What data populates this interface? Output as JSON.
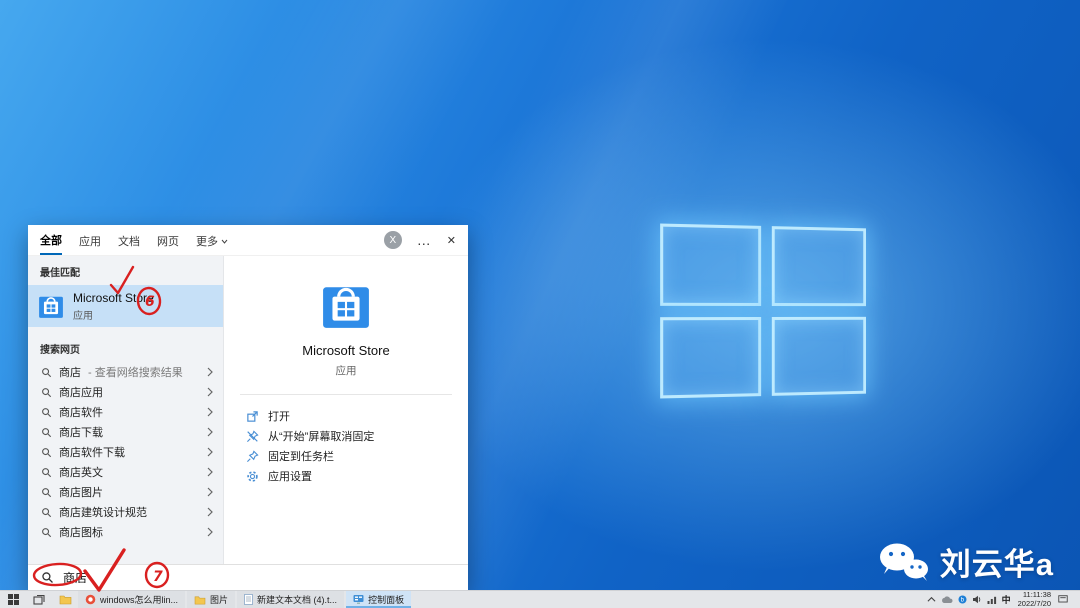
{
  "search_panel": {
    "tabs": {
      "all": "全部",
      "apps": "应用",
      "documents": "文档",
      "web": "网页",
      "more": "更多"
    },
    "header": {
      "clear_badge": "X",
      "more_button": "…",
      "close_button": "✕"
    },
    "sections": {
      "best_match": "最佳匹配",
      "search_web": "搜索网页"
    },
    "best_match_item": {
      "title": "Microsoft Store",
      "subtitle": "应用"
    },
    "web_items": [
      {
        "text": "商店",
        "suffix": " - 查看网络搜索结果"
      },
      {
        "text": "商店应用",
        "suffix": ""
      },
      {
        "text": "商店软件",
        "suffix": ""
      },
      {
        "text": "商店下载",
        "suffix": ""
      },
      {
        "text": "商店软件下载",
        "suffix": ""
      },
      {
        "text": "商店英文",
        "suffix": ""
      },
      {
        "text": "商店图片",
        "suffix": ""
      },
      {
        "text": "商店建筑设计规范",
        "suffix": ""
      },
      {
        "text": "商店图标",
        "suffix": ""
      }
    ],
    "preview": {
      "title": "Microsoft Store",
      "subtitle": "应用",
      "actions": [
        {
          "label": "打开"
        },
        {
          "label": "从“开始”屏幕取消固定"
        },
        {
          "label": "固定到任务栏"
        },
        {
          "label": "应用设置"
        }
      ]
    },
    "search_box": {
      "value": "商店"
    }
  },
  "taskbar": {
    "buttons": [
      {
        "label": "windows怎么用lin..."
      },
      {
        "label": "图片"
      },
      {
        "label": "新建文本文档 (4).t..."
      },
      {
        "label": "控制面板",
        "active": true
      }
    ],
    "tray": {
      "lang": "中",
      "time": "11:11:38",
      "date": "2022/7/20"
    }
  },
  "watermark": {
    "name": "刘云华a"
  },
  "annotations": {
    "step6": "6",
    "step7": "7"
  },
  "colors": {
    "accent": "#0067b8",
    "highlight": "#c6e0f7",
    "annotation": "#d92020",
    "taskbar": "#e4e6e9"
  }
}
